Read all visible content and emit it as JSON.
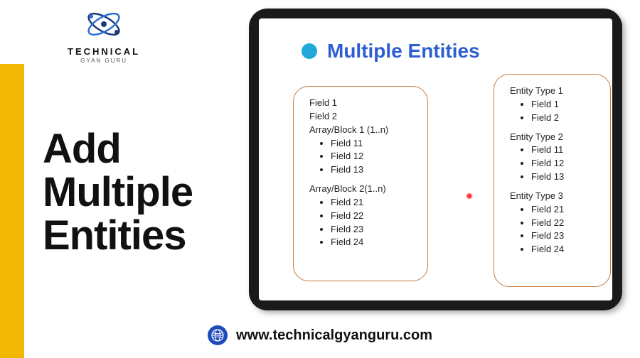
{
  "logo": {
    "main": "TECHNICAL",
    "sub": "GYAN GURU"
  },
  "page_title_line1": "Add",
  "page_title_line2": "Multiple",
  "page_title_line3": "Entities",
  "slide": {
    "title": "Multiple Entities",
    "left_box": {
      "line1": "Field 1",
      "line2": "Field 2",
      "block1": {
        "header": "Array/Block 1 (1..n)",
        "items": {
          "0": "Field 11",
          "1": "Field 12",
          "2": "Field 13"
        }
      },
      "block2": {
        "header": "Array/Block 2(1..n)",
        "items": {
          "0": "Field 21",
          "1": "Field 22",
          "2": "Field 23",
          "3": "Field 24"
        }
      }
    },
    "right_box": {
      "block1": {
        "header": "Entity Type 1",
        "items": {
          "0": "Field 1",
          "1": "Field 2"
        }
      },
      "block2": {
        "header": "Entity Type 2",
        "items": {
          "0": "Field 11",
          "1": "Field 12",
          "2": "Field 13"
        }
      },
      "block3": {
        "header": "Entity Type 3",
        "items": {
          "0": "Field 21",
          "1": "Field 22",
          "2": "Field 23",
          "3": "Field 24"
        }
      }
    }
  },
  "footer_url": "www.technicalgyanguru.com"
}
